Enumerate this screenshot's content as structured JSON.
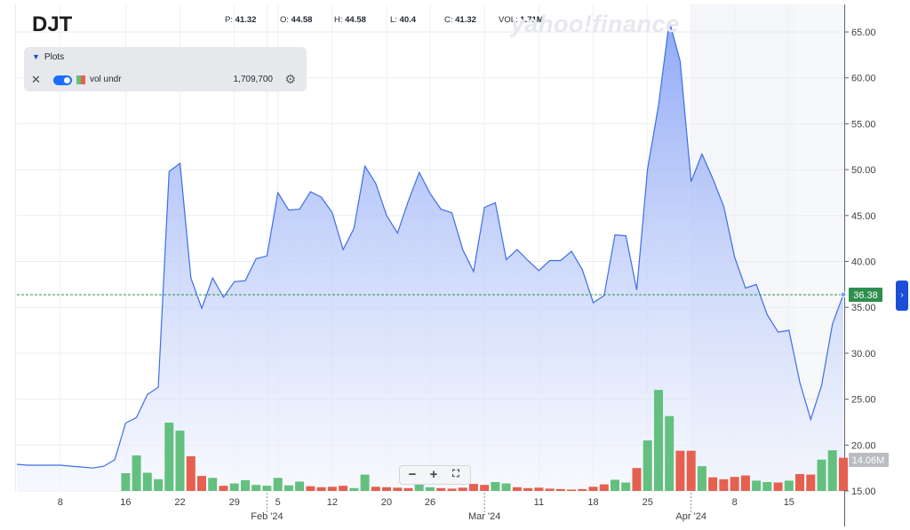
{
  "header": {
    "ticker": "DJT",
    "stats": [
      {
        "label": "P:",
        "value": "41.32"
      },
      {
        "label": "O:",
        "value": "44.58"
      },
      {
        "label": "H:",
        "value": "44.58"
      },
      {
        "label": "L:",
        "value": "40.4"
      },
      {
        "label": "C:",
        "value": "41.32"
      },
      {
        "label": "VOL:",
        "value": "1.71M"
      }
    ],
    "watermark": "yahoo!finance"
  },
  "plots_panel": {
    "title": "Plots",
    "item_name": "vol undr",
    "item_value": "1,709,700",
    "toggle_on": true
  },
  "zoom": {
    "minus": "−",
    "plus": "+",
    "fit": "⛶"
  },
  "colors": {
    "line": "#3d6ee8",
    "area_top": "#8aa5f5",
    "area_bottom": "#f2f5fe",
    "vol_up": "#63c07f",
    "vol_down": "#e5604f",
    "price_badge": "#2f8f4e",
    "vol_badge": "#b9bcc1",
    "highlight": "#eef0f6"
  },
  "chart_data": {
    "type": "area",
    "x_labels": [
      {
        "i": 4,
        "text": "8",
        "sep": false
      },
      {
        "i": 10,
        "text": "16",
        "sep": false
      },
      {
        "i": 15,
        "text": "22",
        "sep": false
      },
      {
        "i": 20,
        "text": "29",
        "sep": false
      },
      {
        "i": 23,
        "text": "Feb '24",
        "sep": true
      },
      {
        "i": 24,
        "text": "5",
        "sep": false
      },
      {
        "i": 29,
        "text": "12",
        "sep": false
      },
      {
        "i": 34,
        "text": "20",
        "sep": false
      },
      {
        "i": 38,
        "text": "26",
        "sep": false
      },
      {
        "i": 43,
        "text": "Mar '24",
        "sep": true
      },
      {
        "i": 48,
        "text": "11",
        "sep": false
      },
      {
        "i": 53,
        "text": "18",
        "sep": false
      },
      {
        "i": 58,
        "text": "25",
        "sep": false
      },
      {
        "i": 62,
        "text": "Apr '24",
        "sep": true
      },
      {
        "i": 66,
        "text": "8",
        "sep": false
      },
      {
        "i": 71,
        "text": "15",
        "sep": false
      }
    ],
    "price": [
      17.9,
      17.8,
      17.8,
      17.8,
      17.8,
      17.7,
      17.6,
      17.5,
      17.7,
      18.4,
      22.4,
      23.0,
      25.5,
      26.3,
      49.8,
      50.7,
      38.2,
      34.9,
      38.2,
      36.1,
      37.8,
      37.9,
      40.3,
      40.6,
      47.5,
      45.6,
      45.7,
      47.6,
      47.0,
      45.3,
      41.3,
      43.6,
      50.4,
      48.5,
      45.0,
      43.1,
      46.6,
      49.7,
      47.4,
      45.7,
      45.3,
      41.3,
      38.9,
      45.9,
      46.4,
      40.2,
      41.3,
      40.1,
      39.0,
      40.1,
      40.1,
      41.1,
      39.1,
      35.5,
      36.3,
      42.9,
      42.8,
      36.9,
      50.1,
      57.0,
      66.2,
      61.8,
      48.7,
      51.7,
      49.0,
      46.0,
      40.5,
      37.1,
      37.5,
      34.2,
      32.3,
      32.5,
      26.8,
      22.8,
      26.5,
      33.2,
      36.4
    ],
    "volume": [
      0,
      0,
      0,
      0,
      0,
      0,
      0,
      0,
      0,
      0,
      3.8,
      7.6,
      3.9,
      2.5,
      14.6,
      12.9,
      7.4,
      3.2,
      2.8,
      1.1,
      1.6,
      2.3,
      1.3,
      1.1,
      2.8,
      1.2,
      2.0,
      1.0,
      0.8,
      0.9,
      1.1,
      0.6,
      3.5,
      0.9,
      0.8,
      0.7,
      0.6,
      1.4,
      0.8,
      0.6,
      0.5,
      0.7,
      1.5,
      1.3,
      1.9,
      1.6,
      0.8,
      0.6,
      0.7,
      0.5,
      0.4,
      0.3,
      0.4,
      0.9,
      1.4,
      2.4,
      1.8,
      4.9,
      10.8,
      21.6,
      16.0,
      8.6,
      8.6,
      5.3,
      2.9,
      2.5,
      3.0,
      3.3,
      2.2,
      1.9,
      1.8,
      2.2,
      3.6,
      3.5,
      6.7,
      8.7,
      7.1
    ],
    "volume_up": [
      false,
      false,
      false,
      false,
      false,
      false,
      false,
      false,
      false,
      false,
      true,
      true,
      true,
      true,
      true,
      true,
      false,
      false,
      true,
      false,
      true,
      true,
      true,
      true,
      true,
      true,
      true,
      false,
      false,
      false,
      false,
      true,
      true,
      false,
      false,
      false,
      false,
      true,
      true,
      false,
      false,
      false,
      false,
      false,
      true,
      true,
      false,
      false,
      false,
      false,
      false,
      false,
      false,
      false,
      false,
      true,
      true,
      false,
      true,
      true,
      true,
      false,
      false,
      true,
      false,
      false,
      false,
      false,
      true,
      true,
      false,
      true,
      false,
      false,
      true,
      true,
      false
    ],
    "ylim": [
      15,
      68
    ],
    "y_ticks": [
      "15.00",
      "20.00",
      "25.00",
      "30.00",
      "35.00",
      "40.00",
      "45.00",
      "50.00",
      "55.00",
      "60.00",
      "65.00"
    ],
    "current_price_label": "36.38",
    "current_volume_label": "14.06M",
    "grid": true
  }
}
